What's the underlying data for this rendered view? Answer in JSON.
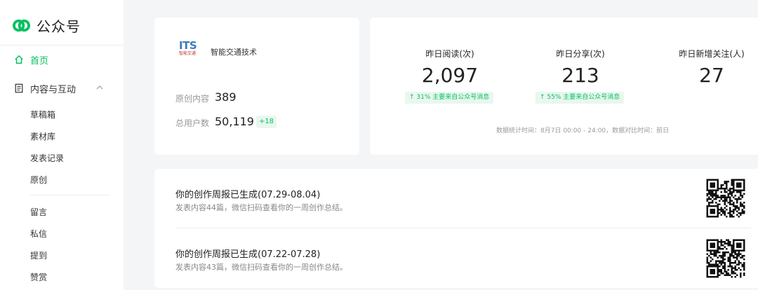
{
  "brand": {
    "name": "公众号",
    "accent": "#07c160"
  },
  "sidebar": {
    "home_label": "首页",
    "group_label": "内容与互动",
    "items": [
      "草稿箱",
      "素材库",
      "发表记录",
      "原创",
      "留言",
      "私信",
      "提到",
      "赞赏"
    ]
  },
  "profile": {
    "logo_text": "ITS",
    "logo_subtext": "智能交通",
    "name": "智能交通技术",
    "original_label": "原创内容",
    "original_value": "389",
    "users_label": "总用户数",
    "users_value": "50,119",
    "users_delta": "+18"
  },
  "stats": {
    "items": [
      {
        "label": "昨日阅读(次)",
        "value": "2,097",
        "badge": "↑ 31%   主要来自公众号消息"
      },
      {
        "label": "昨日分享(次)",
        "value": "213",
        "badge": "↑ 55%   主要来自公众号消息"
      },
      {
        "label": "昨日新增关注(人)",
        "value": "27"
      }
    ],
    "note": "数据统计时间：8月7日 00:00 - 24:00，数据对比时间：前日"
  },
  "reports": [
    {
      "title": "你的创作周报已生成(07.29-08.04)",
      "desc": "发表内容44篇，微信扫码查看你的一周创作总结。"
    },
    {
      "title": "你的创作周报已生成(07.22-07.28)",
      "desc": "发表内容43篇，微信扫码查看你的一周创作总结。"
    }
  ]
}
